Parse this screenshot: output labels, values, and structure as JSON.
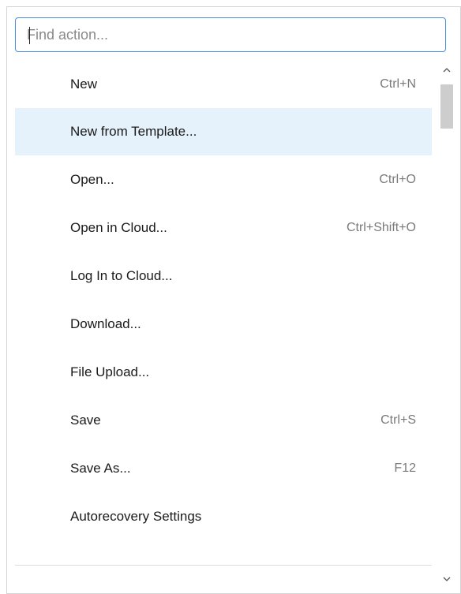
{
  "search": {
    "placeholder": "Find action...",
    "value": ""
  },
  "actions": [
    {
      "label": "New",
      "shortcut": "Ctrl+N",
      "highlighted": false
    },
    {
      "label": "New from Template...",
      "shortcut": "",
      "highlighted": true
    },
    {
      "label": "Open...",
      "shortcut": "Ctrl+O",
      "highlighted": false
    },
    {
      "label": "Open in Cloud...",
      "shortcut": "Ctrl+Shift+O",
      "highlighted": false
    },
    {
      "label": "Log In to Cloud...",
      "shortcut": "",
      "highlighted": false
    },
    {
      "label": "Download...",
      "shortcut": "",
      "highlighted": false
    },
    {
      "label": "File Upload...",
      "shortcut": "",
      "highlighted": false
    },
    {
      "label": "Save",
      "shortcut": "Ctrl+S",
      "highlighted": false
    },
    {
      "label": "Save As...",
      "shortcut": "F12",
      "highlighted": false
    },
    {
      "label": "Autorecovery Settings",
      "shortcut": "",
      "highlighted": false
    }
  ],
  "scrollbar": {
    "up_icon": "chevron-up-icon",
    "down_icon": "chevron-down-icon"
  },
  "colors": {
    "highlight": "#e6f2fb",
    "focus_border": "#4a8fd9",
    "shortcut_text": "#7a7a7a"
  }
}
